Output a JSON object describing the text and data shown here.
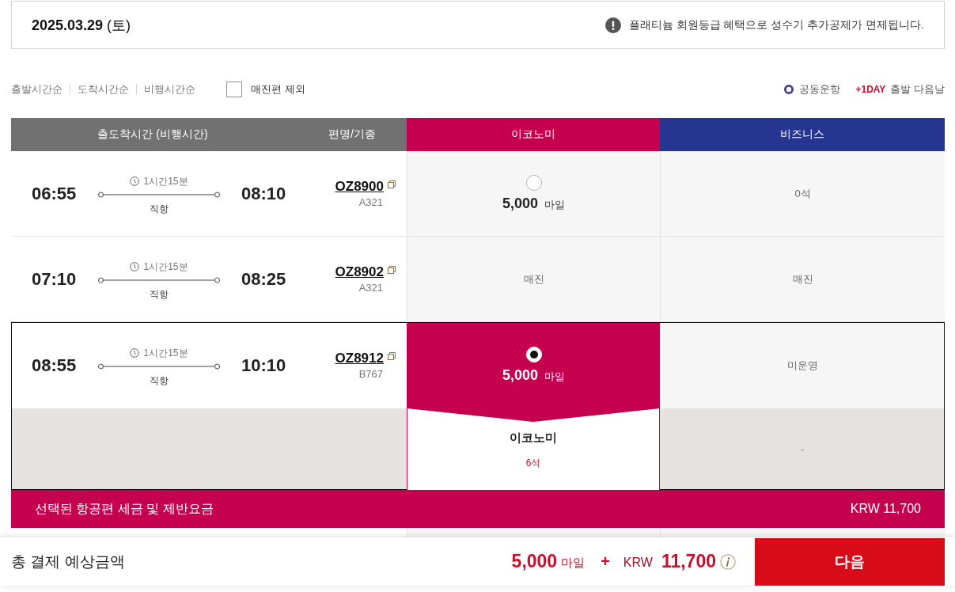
{
  "date_bar": {
    "date": "**2025.03.29** (토)",
    "notice": "플래티늄 회원등급 혜택으로 성수기 추가공제가 면제됩니다."
  },
  "sort_options": [
    {
      "label": "출발시간순",
      "selected": false
    },
    {
      "label": "도착시간순",
      "selected": false
    },
    {
      "label": "비행시간순",
      "selected": false
    }
  ],
  "exclude_sold_out": {
    "label": "매진편 제외",
    "checked": false
  },
  "legend": {
    "codeshare": "공동운항",
    "next_day_tag": "+1DAY",
    "next_day": "출발 다음날"
  },
  "table": {
    "columns": [
      {
        "label": "출도착시간 (비행시간)",
        "kind": "schedule"
      },
      {
        "label": "편명/기종",
        "kind": "flight"
      },
      {
        "label": "이코노미",
        "kind": "economy"
      },
      {
        "label": "비즈니스",
        "kind": "business"
      }
    ],
    "rows": [
      {
        "departure": "06:55",
        "duration": "1시간15분",
        "stops": "직항",
        "arrival": "08:10",
        "flight_no": "OZ8900",
        "aircraft": "A321",
        "selected": false,
        "economy": {
          "kind": "fare",
          "amount": "5,000",
          "unit": "마일",
          "selected": false
        },
        "business": {
          "kind": "status",
          "text": "0석"
        }
      },
      {
        "departure": "07:10",
        "duration": "1시간15분",
        "stops": "직항",
        "arrival": "08:25",
        "flight_no": "OZ8902",
        "aircraft": "A321",
        "selected": false,
        "economy": {
          "kind": "status",
          "text": "매진"
        },
        "business": {
          "kind": "status",
          "text": "매진"
        }
      },
      {
        "departure": "08:55",
        "duration": "1시간15분",
        "stops": "직항",
        "arrival": "10:10",
        "flight_no": "OZ8912",
        "aircraft": "B767",
        "selected": true,
        "economy": {
          "kind": "fare",
          "amount": "5,000",
          "unit": "마일",
          "selected": true
        },
        "business": {
          "kind": "status",
          "text": "미운영"
        },
        "detail": {
          "cabin": "이코노미",
          "seats": "6석",
          "business": "-"
        }
      }
    ]
  },
  "tax_bar": {
    "label": "선택된 항공편 세금 및 제반요금",
    "amount": "KRW 11,700"
  },
  "total_bar": {
    "label": "총 결제 예상금액",
    "miles": "5,000",
    "miles_unit": "마일",
    "plus": "+",
    "currency": "KRW",
    "amount": "11,700",
    "button": "다음"
  }
}
